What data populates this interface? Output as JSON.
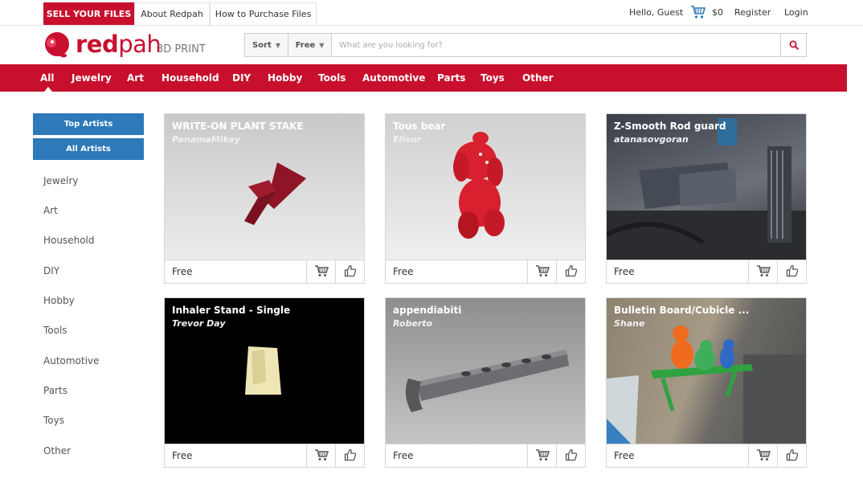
{
  "topbar": {
    "sell_label": "SELL YOUR FILES",
    "about_label": "About Redpah",
    "purchase_label": "How to Purchase Files",
    "greeting": "Hello, Guest",
    "cart_amount": "$0",
    "register_label": "Register",
    "login_label": "Login"
  },
  "brand": {
    "name_bold": "red",
    "name_light": "pah",
    "sub": "3D PRINT",
    "color": "#c8102e"
  },
  "search": {
    "sort_label": "Sort",
    "filter_label": "Free",
    "placeholder": "What are you looking for?",
    "value": ""
  },
  "categories": [
    "All",
    "Jewelry",
    "Art",
    "Household",
    "DIY",
    "Hobby",
    "Tools",
    "Automotive",
    "Parts",
    "Toys",
    "Other"
  ],
  "sidebar": {
    "top_artists": "Top Artists",
    "all_artists": "All Artists",
    "links": [
      "Jewelry",
      "Art",
      "Household",
      "DIY",
      "Hobby",
      "Tools",
      "Automotive",
      "Parts",
      "Toys",
      "Other"
    ]
  },
  "products": [
    {
      "title": "WRITE-ON PLANT STAKE",
      "author": "PanamaMikey",
      "price": "Free"
    },
    {
      "title": "Tous bear",
      "author": "Elisur",
      "price": "Free"
    },
    {
      "title": "Z-Smooth Rod guard",
      "author": "atanasovgoran",
      "price": "Free"
    },
    {
      "title": "Inhaler Stand - Single",
      "author": "Trevor Day",
      "price": "Free"
    },
    {
      "title": "appendiabiti",
      "author": "Roberto",
      "price": "Free"
    },
    {
      "title": "Bulletin Board/Cubicle ...",
      "author": "Shane",
      "price": "Free"
    }
  ],
  "colors": {
    "accent_red": "#c8102e",
    "sidebar_blue": "#2e79b9"
  }
}
